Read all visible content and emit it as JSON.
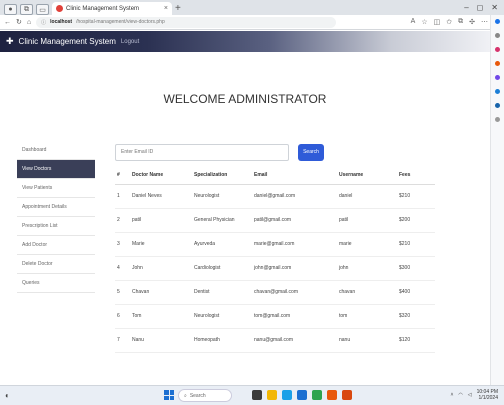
{
  "browser": {
    "tab_title": "Clinic Management System",
    "url_prefix": "localhost",
    "url_path": "/hospital-management/view-doctors.php",
    "window_controls": [
      "–",
      "◻",
      "✕"
    ]
  },
  "app": {
    "brand": "Clinic Management System",
    "logout": "Logout"
  },
  "page": {
    "heading": "WELCOME ADMINISTRATOR"
  },
  "sidebar": {
    "items": [
      {
        "label": "Dashboard",
        "active": false
      },
      {
        "label": "View Doctors",
        "active": true
      },
      {
        "label": "View Patients",
        "active": false
      },
      {
        "label": "Appointment Details",
        "active": false
      },
      {
        "label": "Prescription List",
        "active": false
      },
      {
        "label": "Add Doctor",
        "active": false
      },
      {
        "label": "Delete Doctor",
        "active": false
      },
      {
        "label": "Queries",
        "active": false
      }
    ]
  },
  "search": {
    "placeholder": "Enter Email ID",
    "button": "Search"
  },
  "table": {
    "headers": [
      "#",
      "Doctor Name",
      "Specialization",
      "Email",
      "Username",
      "Fees"
    ],
    "rows": [
      [
        "1",
        "Daniel Neves",
        "Neurologist",
        "daniel@gmail.com",
        "daniel",
        "$210"
      ],
      [
        "2",
        "patil",
        "General Physician",
        "patil@gmail.com",
        "patil",
        "$200"
      ],
      [
        "3",
        "Marie",
        "Ayurveda",
        "marie@gmail.com",
        "marie",
        "$210"
      ],
      [
        "4",
        "John",
        "Cardiologist",
        "john@gmail.com",
        "john",
        "$300"
      ],
      [
        "5",
        "Chavan",
        "Dentist",
        "chavan@gmail.com",
        "chavan",
        "$400"
      ],
      [
        "6",
        "Tom",
        "Neurologist",
        "tom@gmail.com",
        "tom",
        "$320"
      ],
      [
        "7",
        "Nanu",
        "Homeopath",
        "nanu@gmail.com",
        "nanu",
        "$120"
      ]
    ]
  },
  "taskbar": {
    "search": "Search",
    "time": "10:04 PM",
    "date": "1/1/2024"
  },
  "colors": {
    "active_sidebar": "#3a3f58",
    "search_button": "#2f5bd8",
    "appbar_dark": "#1e2240"
  }
}
